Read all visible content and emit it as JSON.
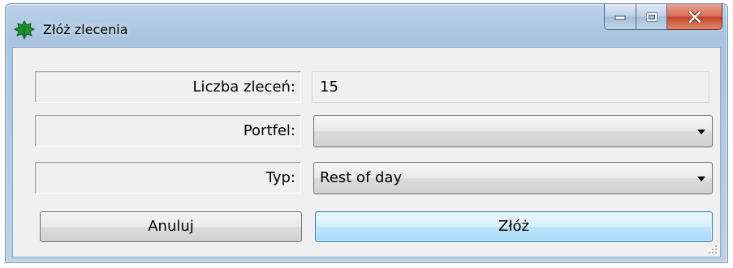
{
  "window": {
    "title": "Złóż zlecenia",
    "icon": "green-leaf-icon"
  },
  "caption_buttons": [
    "minimize-icon",
    "maximize-icon",
    "close-icon"
  ],
  "form": {
    "count_label": "Liczba zleceń:",
    "count_value": "15",
    "portfolio_label": "Portfel:",
    "portfolio_value": "",
    "type_label": "Typ:",
    "type_value": "Rest of day"
  },
  "buttons": {
    "cancel_label": "Anuluj",
    "submit_label": "Złóż"
  },
  "colors": {
    "title_gradient": "#a9c4df",
    "client_bg": "#f0f0f0",
    "close_button": "#c2442a",
    "default_button_border": "#3c7fb1"
  }
}
